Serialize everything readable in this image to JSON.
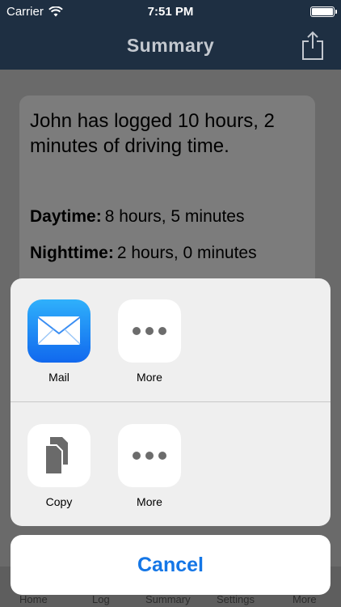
{
  "status": {
    "carrier": "Carrier",
    "time": "7:51 PM"
  },
  "nav": {
    "title": "Summary",
    "share_icon": "share-icon"
  },
  "summary": {
    "text": "John has logged 10 hours, 2 minutes of driving time.",
    "daytime_label": "Daytime:",
    "daytime_value": "8 hours, 5 minutes",
    "nighttime_label": "Nighttime:",
    "nighttime_value": "2 hours, 0 minutes"
  },
  "tabs": [
    "Home",
    "Log",
    "Summary",
    "Settings",
    "More"
  ],
  "share_sheet": {
    "apps": [
      {
        "label": "Mail",
        "icon": "mail-icon"
      },
      {
        "label": "More",
        "icon": "more-icon"
      }
    ],
    "actions": [
      {
        "label": "Copy",
        "icon": "copy-icon"
      },
      {
        "label": "More",
        "icon": "more-icon"
      }
    ],
    "cancel_label": "Cancel"
  },
  "colors": {
    "nav_bg": "#1e2f42",
    "accent": "#1476e6",
    "mail_gradient": [
      "#2fb0fb",
      "#1168ee"
    ]
  }
}
